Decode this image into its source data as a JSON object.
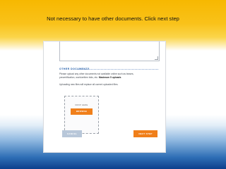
{
  "caption": "Not necessary to have other documents.  Click next step",
  "section": {
    "title": "OTHER DOCUMENTS",
    "description_prefix": "Please upload any other documents not available online such as leases, precertification, work/written bids, etc. ",
    "description_emphasis": "Maximum 5 uploads",
    "warning": "Uploading new files will replace all current uploaded files."
  },
  "upload": {
    "drop_label": "DROP HERE",
    "browse_label": "BROWSE"
  },
  "footer": {
    "cancel_label": "CANCEL",
    "next_label": "NEXT STEP"
  },
  "colors": {
    "accent_orange": "#f07f1a",
    "cancel_grey_blue": "#b8c7d9",
    "section_blue": "#1e5aa8",
    "top_gradient_yellow": "#f7b800",
    "bottom_gradient_blue": "#0c3f8c"
  }
}
